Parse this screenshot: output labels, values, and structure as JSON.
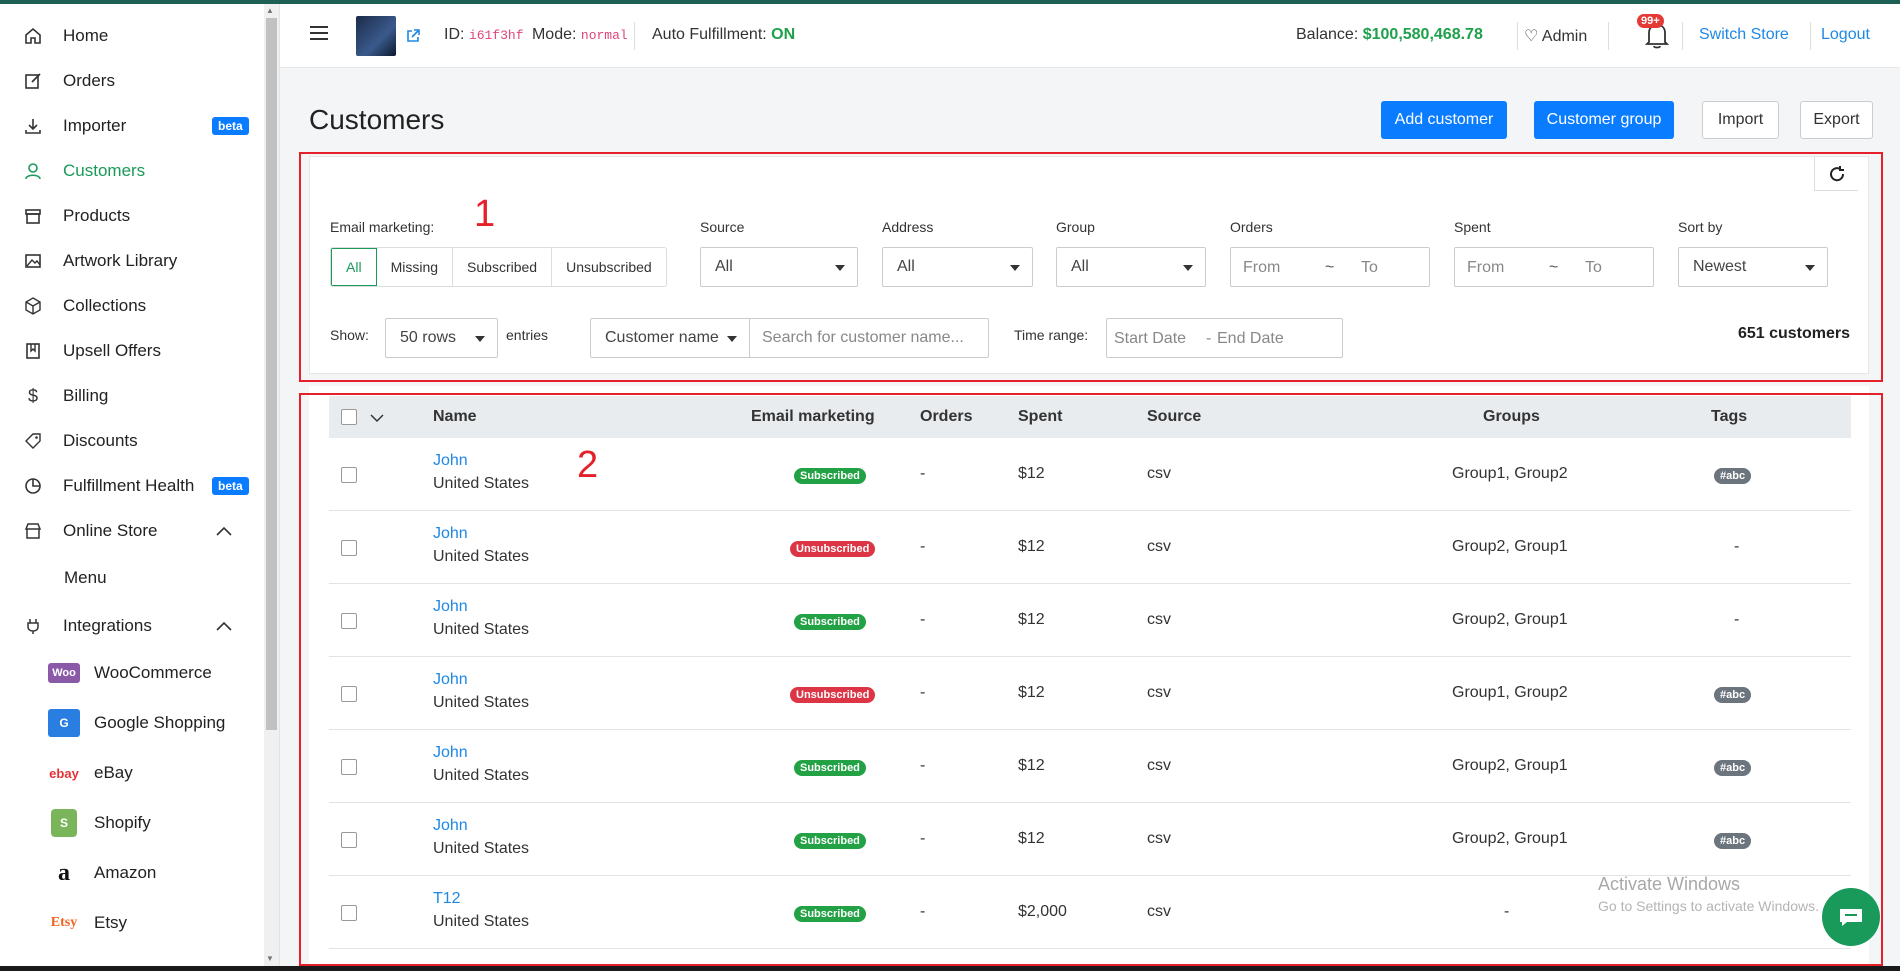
{
  "sidebar": {
    "items": [
      {
        "label": "Home",
        "icon": "home-icon"
      },
      {
        "label": "Orders",
        "icon": "edit-icon"
      },
      {
        "label": "Importer",
        "icon": "download-icon",
        "badge": "beta"
      },
      {
        "label": "Customers",
        "icon": "user-icon",
        "active": true
      },
      {
        "label": "Products",
        "icon": "box-icon"
      },
      {
        "label": "Artwork Library",
        "icon": "image-icon"
      },
      {
        "label": "Collections",
        "icon": "cube-icon"
      },
      {
        "label": "Upsell Offers",
        "icon": "book-icon"
      },
      {
        "label": "Billing",
        "icon": "dollar-icon"
      },
      {
        "label": "Discounts",
        "icon": "tag-icon"
      },
      {
        "label": "Fulfillment Health",
        "icon": "pie-icon",
        "badge": "beta"
      },
      {
        "label": "Online Store",
        "icon": "store-icon"
      },
      {
        "label": "Integrations",
        "icon": "plug-icon"
      }
    ],
    "online_store_sub": "Menu",
    "integrations": [
      "WooCommerce",
      "Google Shopping",
      "eBay",
      "Shopify",
      "Amazon",
      "Etsy"
    ],
    "badge_text": "beta"
  },
  "header": {
    "id_label": "ID:",
    "id_value": "i61f3hf",
    "mode_label": "Mode:",
    "mode_value": "normal",
    "auto_label": "Auto Fulfillment:",
    "auto_value": "ON",
    "balance_label": "Balance:",
    "balance_value": "$100,580,468.78",
    "user": "Admin",
    "notif_count": "99+",
    "switch_store": "Switch Store",
    "logout": "Logout"
  },
  "page": {
    "title": "Customers",
    "buttons": {
      "add_customer": "Add customer",
      "customer_group": "Customer group",
      "import": "Import",
      "export": "Export"
    }
  },
  "filters": {
    "email_marketing_label": "Email marketing:",
    "email_options": [
      "All",
      "Missing",
      "Subscribed",
      "Unsubscribed"
    ],
    "source_label": "Source",
    "source_value": "All",
    "address_label": "Address",
    "address_value": "All",
    "group_label": "Group",
    "group_value": "All",
    "orders_label": "Orders",
    "spent_label": "Spent",
    "from": "From",
    "to": "To",
    "tilde": "~",
    "sort_label": "Sort by",
    "sort_value": "Newest",
    "show_label": "Show:",
    "rows_value": "50 rows",
    "entries_label": "entries",
    "search_field": "Customer name",
    "search_placeholder": "Search for customer name...",
    "time_range_label": "Time range:",
    "start_date": "Start Date",
    "dash": "-",
    "end_date": "End Date",
    "count": "651 customers"
  },
  "table": {
    "headers": [
      "Name",
      "Email marketing",
      "Orders",
      "Spent",
      "Source",
      "Groups",
      "Tags"
    ],
    "rows": [
      {
        "name": "John",
        "country": "United States",
        "email": "Subscribed",
        "orders": "-",
        "spent": "$12",
        "source": "csv",
        "groups": "Group1, Group2",
        "tag": "#abc"
      },
      {
        "name": "John",
        "country": "United States",
        "email": "Unsubscribed",
        "orders": "-",
        "spent": "$12",
        "source": "csv",
        "groups": "Group2, Group1",
        "tag": "-"
      },
      {
        "name": "John",
        "country": "United States",
        "email": "Subscribed",
        "orders": "-",
        "spent": "$12",
        "source": "csv",
        "groups": "Group2, Group1",
        "tag": "-"
      },
      {
        "name": "John",
        "country": "United States",
        "email": "Unsubscribed",
        "orders": "-",
        "spent": "$12",
        "source": "csv",
        "groups": "Group1, Group2",
        "tag": "#abc"
      },
      {
        "name": "John",
        "country": "United States",
        "email": "Subscribed",
        "orders": "-",
        "spent": "$12",
        "source": "csv",
        "groups": "Group2, Group1",
        "tag": "#abc"
      },
      {
        "name": "John",
        "country": "United States",
        "email": "Subscribed",
        "orders": "-",
        "spent": "$12",
        "source": "csv",
        "groups": "Group2, Group1",
        "tag": "#abc"
      },
      {
        "name": "T12",
        "country": "United States",
        "email": "Subscribed",
        "orders": "-",
        "spent": "$2,000",
        "source": "csv",
        "groups": "-",
        "tag": ""
      }
    ]
  },
  "annotations": [
    "1",
    "2"
  ],
  "watermark": {
    "line1": "Activate Windows",
    "line2": "Go to Settings to activate Windows."
  },
  "colors": {
    "accent_green": "#1a9a5a",
    "primary_blue": "#0a7cff",
    "subscribed": "#23a145",
    "unsubscribed": "#dc3545",
    "annotation_red": "#e5202a"
  }
}
